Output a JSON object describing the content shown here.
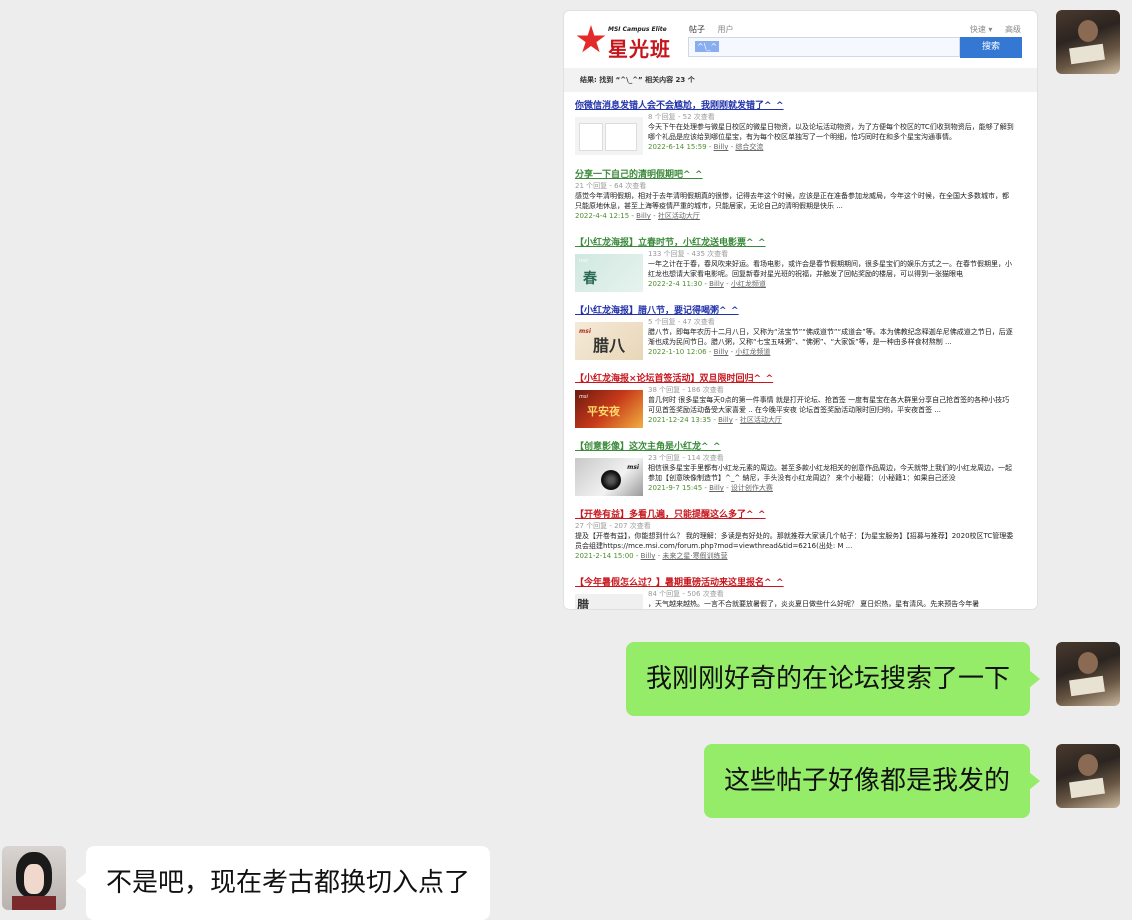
{
  "forum": {
    "logo_small": "MSI Campus Elite",
    "logo_big": "星光班",
    "tab_posts": "帖子",
    "tab_users": "用户",
    "opt_quick": "快速 ▾",
    "opt_advanced": "高级",
    "search_query": "^\\_^",
    "search_button": "搜索",
    "result_summary": "结果: 找到 “^\\_^” 相关内容 23 个",
    "results": [
      {
        "title": "你微信消息发错人会不会尴尬，我刚刚就发错了^_^",
        "meta": "8 个回复 - 52 次查看",
        "snippet": "今天下午在处理参与微星日校区的微星日物资，以及论坛活动物资，为了方便每个校区的TC们收到物资后，能够了解到哪个礼品是应该给到哪位星宝，有为每个校区单独写了一个明细，恰巧同时在和多个星宝沟通事情。",
        "date": "2022-6-14 15:59",
        "author": "Billy",
        "forum": "综合交流"
      },
      {
        "title": "分享一下自己的清明假期吧^_^",
        "meta": "21 个回复 - 64 次查看",
        "snippet": "感觉今年清明假期，相对于去年清明假期真的很惨，记得去年这个时候，应该是正在准备参加龙威局，今年这个时候，在全国大多数城市，都只能原地休息，甚至上海等疫情严重的城市，只能居家，无论自己的清明假期是快乐 ...",
        "date": "2022-4-4 12:15",
        "author": "Billy",
        "forum": "社区活动大厅"
      },
      {
        "title": "【小红龙海报】立春时节，小红龙送电影票^_^",
        "meta": "133 个回复 - 435 次查看",
        "snippet": "一年之计在于春，春风吹来好运。看场电影，或许会是春节假期期间，很多星宝们的娱乐方式之一。在春节假期里，小红龙也想请大家看电影呢。回复新春对星光班的祝福，并触发了回帖奖励的楼层，可以得到一张猫眼电",
        "date": "2022-2-4 11:30",
        "author": "Billy",
        "forum": "小红龙频道",
        "thumb_text": "春"
      },
      {
        "title": "【小红龙海报】腊八节，要记得喝粥^_^",
        "meta": "5 个回复 - 47 次查看",
        "snippet": "腊八节，即每年农历十二月八日，又称为“法宝节”“佛成道节”“成道会”等。本为佛教纪念释迦牟尼佛成道之节日，后逐渐也成为民间节日。腊八粥，又称“七宝五味粥”、“佛粥”、“大家饭”等，是一种由多样食材熬制 ...",
        "date": "2022-1-10 12:06",
        "author": "Billy",
        "forum": "小红龙频道",
        "thumb_text": "腊八"
      },
      {
        "title": "【小红龙海报×论坛首签活动】双旦限时回归^_^",
        "meta": "38 个回复 - 186 次查看",
        "snippet": "曾几何时 很多星宝每天0点的第一件事情 就是打开论坛、抢首签 一度有星宝在各大群里分享自己抢首签的各种小技巧 可见首签奖励活动备受大家喜爱 .. 在今晚平安夜 论坛首签奖励活动限时回归哟，平安夜首签 ...",
        "date": "2021-12-24 13:35",
        "author": "Billy",
        "forum": "社区活动大厅",
        "thumb_text": "平安夜"
      },
      {
        "title": "【创意影像】这次主角是小红龙^_^",
        "meta": "23 个回复 - 114 次查看",
        "snippet": "相信很多星宝手里都有小红龙元素的周边。甚至多款小红龙相关的创意作品周边，今天就带上我们的小红龙周边，一起参加【创意映像制造节】^_^ 納尼，手头没有小红龙周边？ 来个小秘籍：（小秘籍1：如果自己还没",
        "date": "2021-9-7 15:45",
        "author": "Billy",
        "forum": "设计创作大赛",
        "thumb_text": "msi"
      },
      {
        "title": "【开卷有益】多看几遍，只能提醒这么多了^_^",
        "meta": "27 个回复 - 207 次查看",
        "snippet": "提及【开卷有益】，你能想到什么？ 我的理解：多读是有好处的。那就推荐大家读几个帖子：【为星宝服务】【招募与推荐】2020校区TC管理委员会组建https://mce.msi.com/forum.php?mod=viewthread&tid=6216(出处: M ...",
        "date": "2021-2-14 15:00",
        "author": "Billy",
        "forum": "未来之星·寒假训练营"
      },
      {
        "title": "【今年暑假怎么过？】暑期重磅活动来这里报名^_^",
        "meta": "84 个回复 - 506 次查看",
        "snippet": "，天气越来越热。一言不合就要放暑假了，炎炎夏日做些什么好呢？ 夏日炽热，星有清风。先来预告今年暑",
        "date": "",
        "author": "",
        "forum": ""
      }
    ]
  },
  "messages": [
    {
      "text": "我刚刚好奇的在论坛搜索了一下"
    },
    {
      "text": "这些帖子好像都是我发的"
    },
    {
      "text": "不是吧，现在考古都换切入点了"
    }
  ]
}
